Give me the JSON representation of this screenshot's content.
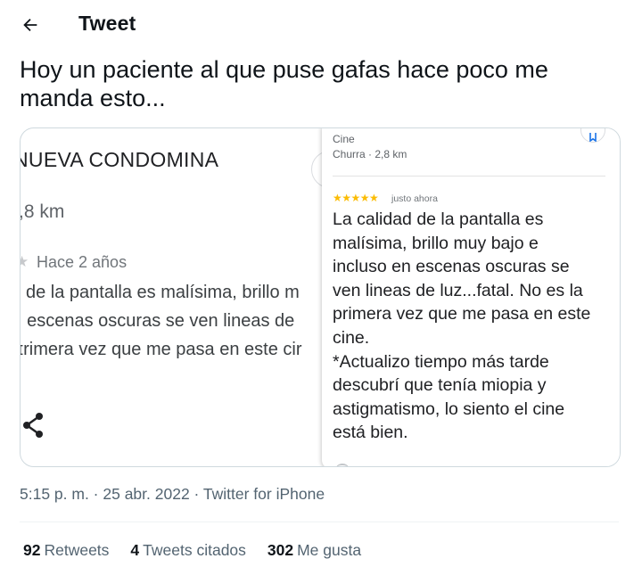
{
  "header": {
    "title": "Tweet",
    "back_icon": "arrow-left-icon"
  },
  "tweet": {
    "text": "Hoy un paciente al que puse gafas hace poco me manda esto...",
    "timestamp": "5:15 p. m. · 25 abr. 2022 · Twitter for iPhone"
  },
  "media": {
    "left": {
      "title": "NUEVA CONDOMINA",
      "distance": ",8 km",
      "date": "Hace 2 años",
      "review_lines": [
        "l de la pantalla es malísima, brillo m",
        "ı escenas oscuras se ven lineas de",
        "ɪrimera vez que me pasa en este cir"
      ]
    },
    "right": {
      "category": "Cine",
      "location": "Churra · 2,8 km",
      "stars": "★★★★★",
      "time": "justo ahora",
      "review": "La calidad de la pantalla es\nmalísima, brillo muy bajo e\nincluso en escenas oscuras se\nven lineas de luz...fatal. No es la\nprimera vez que me pasa en este\ncine.\n*Actualizo tiempo más tarde\ndescubrí que tenía miopia y\nastigmatismo, lo siento el cine\nestá bien."
    }
  },
  "stats": {
    "retweets_count": "92",
    "retweets_label": "Retweets",
    "quotes_count": "4",
    "quotes_label": "Tweets citados",
    "likes_count": "302",
    "likes_label": "Me gusta"
  },
  "colors": {
    "star": "#fbbc04",
    "secondary_text": "#536471"
  }
}
